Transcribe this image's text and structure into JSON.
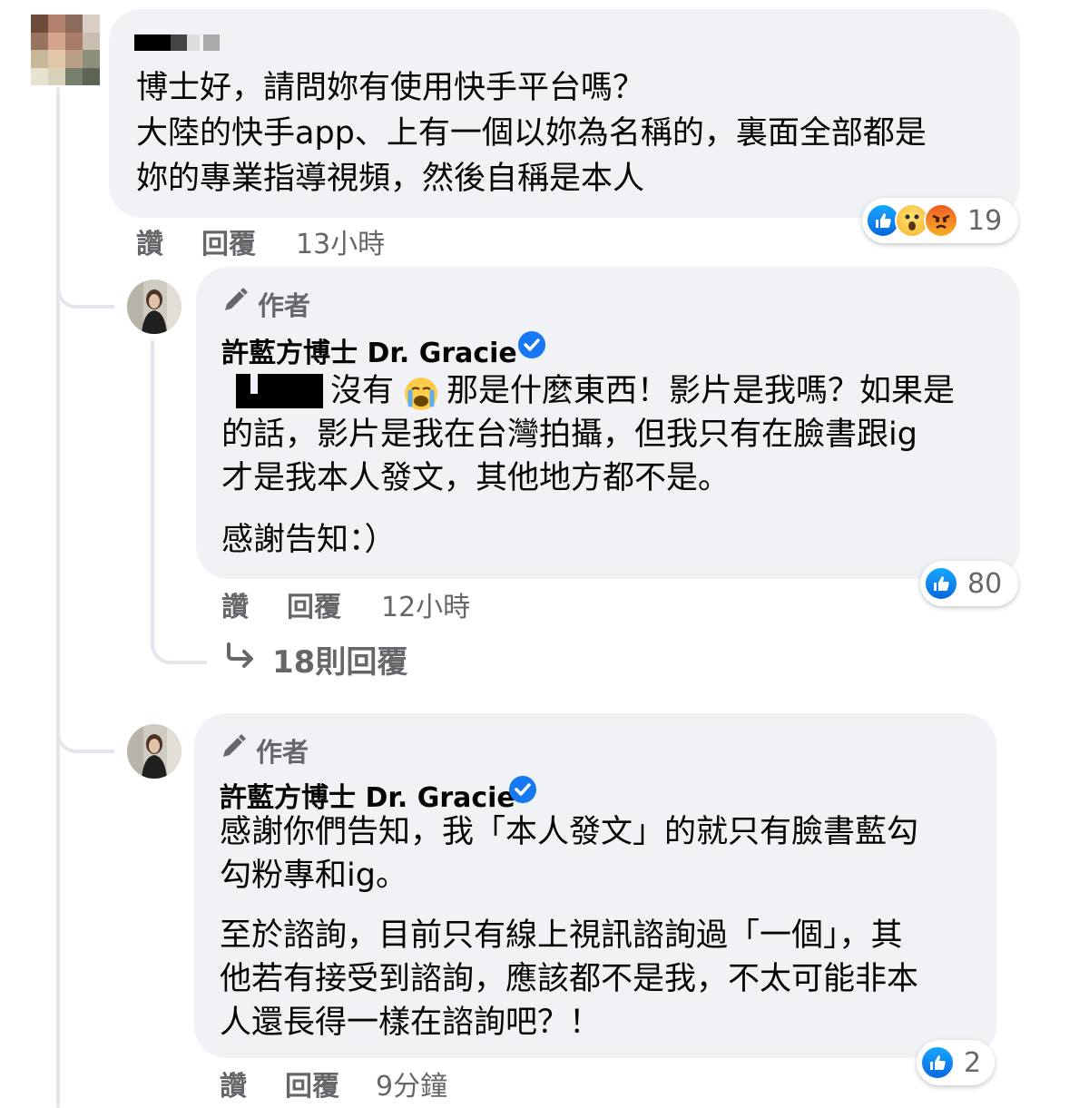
{
  "comment1": {
    "author_redacted": true,
    "lines": [
      "博士好，請問妳有使用快手平台嗎？",
      "大陸的快手app、上有一個以妳為名稱的，裏面全部都是",
      "妳的專業指導視頻，然後自稱是本人"
    ],
    "actions": {
      "like": "讚",
      "reply": "回覆",
      "time": "13小時"
    },
    "reactions": {
      "icons": [
        "like-icon",
        "wow-icon",
        "angry-icon"
      ],
      "count": "19"
    }
  },
  "reply1": {
    "badge": "作者",
    "author": "許藍方博士 Dr. Gracie",
    "verified_icon": "verified-check-icon",
    "first_line_after_mention": "沒有",
    "emoji": "crying-face-emoji",
    "first_line_tail": "那是什麼東西！影片是我嗎？如果是",
    "lines": [
      "的話，影片是我在台灣拍攝，但我只有在臉書跟ig",
      "才是我本人發文，其他地方都不是。"
    ],
    "closing": "感謝告知：）",
    "actions": {
      "like": "讚",
      "reply": "回覆",
      "time": "12小時"
    },
    "reactions": {
      "icons": [
        "like-icon"
      ],
      "count": "80"
    }
  },
  "more_replies": {
    "icon": "reply-arrow-icon",
    "label": "18則回覆"
  },
  "reply2": {
    "badge": "作者",
    "author": "許藍方博士 Dr. Gracie",
    "verified_icon": "verified-check-icon",
    "para1": [
      "感謝你們告知，我「本人發文」的就只有臉書藍勾",
      "勾粉專和ig。"
    ],
    "para2": [
      "至於諮詢，目前只有線上視訊諮詢過「一個」，其",
      "他若有接受到諮詢，應該都不是我，不太可能非本",
      "人還長得一樣在諮詢吧？！"
    ],
    "actions": {
      "like": "讚",
      "reply": "回覆",
      "time": "9分鐘"
    },
    "reactions": {
      "icons": [
        "like-icon"
      ],
      "count": "2"
    }
  },
  "colors": {
    "bubble": "#f0f2f5",
    "secondary_text": "#65676b",
    "verified": "#1877f2",
    "thread_line": "#e4e6eb"
  }
}
